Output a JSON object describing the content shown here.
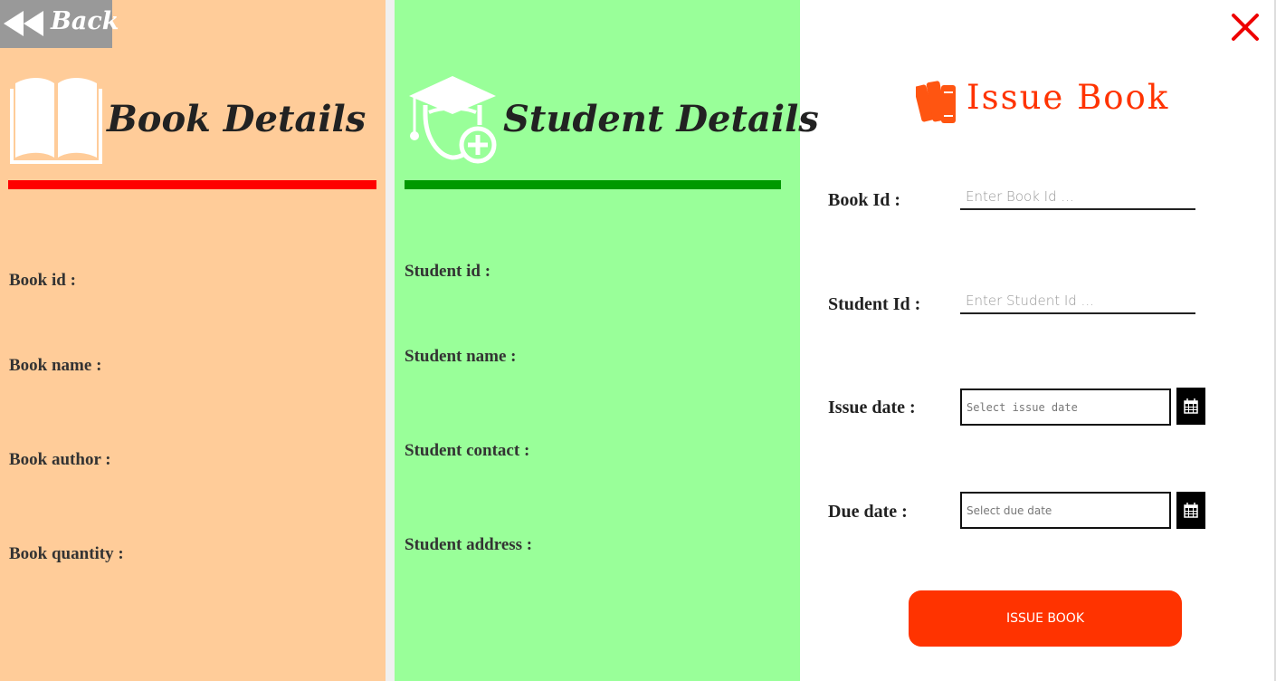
{
  "back": {
    "label": "Back"
  },
  "book_panel": {
    "title": "Book Details",
    "rule_color": "#ff0000",
    "fields": [
      "Book id :",
      "Book name :",
      "Book author :",
      "Book quantity :"
    ]
  },
  "student_panel": {
    "title": "Student Details",
    "rule_color": "#009900",
    "fields": [
      "Student id :",
      "Student name :",
      "Student contact :",
      "Student address :"
    ]
  },
  "issue_panel": {
    "title": "Issue Book",
    "book_id": {
      "label": "Book Id :",
      "placeholder": "Enter Book Id ...",
      "value": ""
    },
    "student_id": {
      "label": "Student Id :",
      "placeholder": "Enter Student Id ...",
      "value": ""
    },
    "issue_date": {
      "label": "Issue date :",
      "placeholder": "Select issue date"
    },
    "due_date": {
      "label": "Due date :",
      "placeholder": "Select due date"
    },
    "button_label": "ISSUE BOOK"
  },
  "colors": {
    "book_panel_bg": "#ffcc99",
    "student_panel_bg": "#99ff99",
    "accent": "#ff3300",
    "close": "#ee0000"
  },
  "icons": [
    "rewind-icon",
    "open-book-icon",
    "student-graduate-add-icon",
    "books-icon",
    "calendar-icon",
    "close-icon"
  ]
}
